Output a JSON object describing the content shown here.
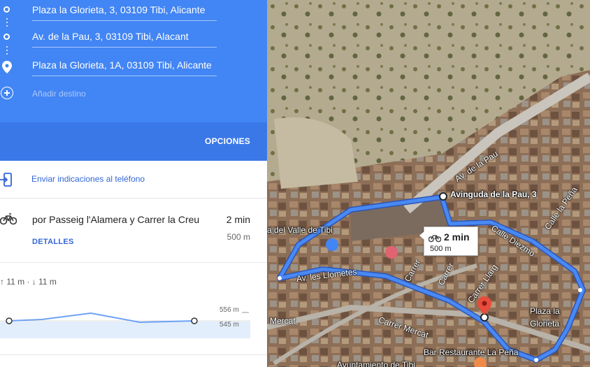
{
  "waypoints": [
    {
      "value": "Plaza la Glorieta, 3, 03109 Tibi, Alicante"
    },
    {
      "value": "Av. de la Pau, 3, 03109 Tibi, Alacant"
    },
    {
      "value": "Plaza la Glorieta, 1A, 03109 Tibi, Alicante"
    }
  ],
  "add_destination": "Añadir destino",
  "options_label": "OPCIONES",
  "send_to_phone": "Enviar indicaciones al teléfono",
  "route": {
    "via": "por Passeig l'Alamera y Carrer la Creu",
    "time": "2 min",
    "distance": "500 m",
    "details_label": "DETALLES"
  },
  "elevation": {
    "summary": "↑ 11 m · ↓ 11 m",
    "max_label": "556 m",
    "min_label": "545 m"
  },
  "map": {
    "labels": {
      "avinguda": "Avinguda de la Pau, 3",
      "plaza": "Plaza la",
      "plaza2": "Glorieta",
      "valle": "a del Valle de Tibi",
      "bar": "Bar Restaurante La Peña",
      "ayunt": "Ayuntamiento de Tibi"
    },
    "streets": {
      "av_pau": "Av. de la Pau",
      "llometes": "Av. les Llometes",
      "diezmo": "Calle Diezmo",
      "pena": "Calle la Peña",
      "mercat": "Carrer Mercat",
      "mercat2": "Mercat",
      "llarg": "Carrer Llarg",
      "carrer": "Carrer",
      "carrer2": "Carrer"
    },
    "callout": {
      "time": "2 min",
      "distance": "500 m"
    }
  },
  "colors": {
    "header": "#4285f4",
    "route": "#4a89f3",
    "link": "#3367d6"
  }
}
